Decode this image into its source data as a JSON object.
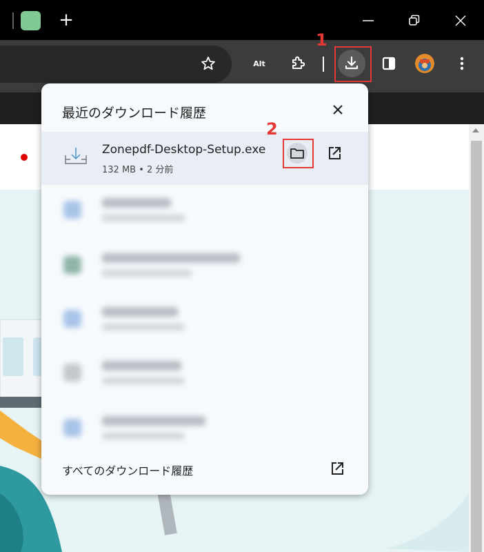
{
  "window": {
    "new_tab_label": "+"
  },
  "toolbar": {
    "alt_label": "Alt"
  },
  "annotations": {
    "step1": "1",
    "step2": "2"
  },
  "downloads_panel": {
    "title": "最近のダウンロード履歴",
    "items": [
      {
        "filename": "Zonepdf-Desktop-Setup.exe",
        "meta": "132 MB • 2 分前"
      }
    ],
    "footer_label": "すべてのダウンロード履歴"
  },
  "colors": {
    "annotation_red": "#e53935",
    "tab_favicon": "#81c995",
    "panel_bg": "#f6fafd",
    "selected_row_bg": "#e9eef6"
  }
}
